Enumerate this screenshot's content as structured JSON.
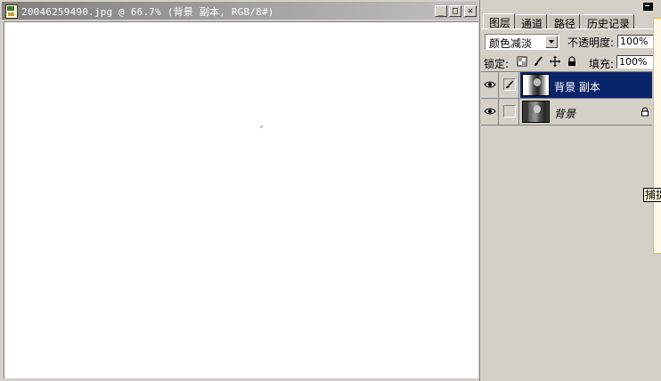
{
  "document": {
    "title": "20046259490.jpg @ 66.7% (背景 副本, RGB/8#)",
    "minimize_label": "_",
    "maximize_label": "□",
    "close_label": "×"
  },
  "layers_panel": {
    "tabs": [
      {
        "label": "图层",
        "active": true
      },
      {
        "label": "通道",
        "active": false
      },
      {
        "label": "路径",
        "active": false
      },
      {
        "label": "历史记录",
        "active": false
      }
    ],
    "blend_mode": "颜色减淡",
    "opacity_label": "不透明度:",
    "opacity_value": "100%",
    "lock_label": "锁定:",
    "fill_label": "填充:",
    "fill_value": "100%",
    "layers": [
      {
        "name": "背景 副本",
        "selected": true,
        "locked": false
      },
      {
        "name": "背景",
        "selected": false,
        "locked": true
      }
    ]
  },
  "tooltip": {
    "text": "捕捉"
  },
  "colors": {
    "selection": "#0a246a",
    "face": "#d4d0c8",
    "titlebar_inactive": "#808080"
  }
}
